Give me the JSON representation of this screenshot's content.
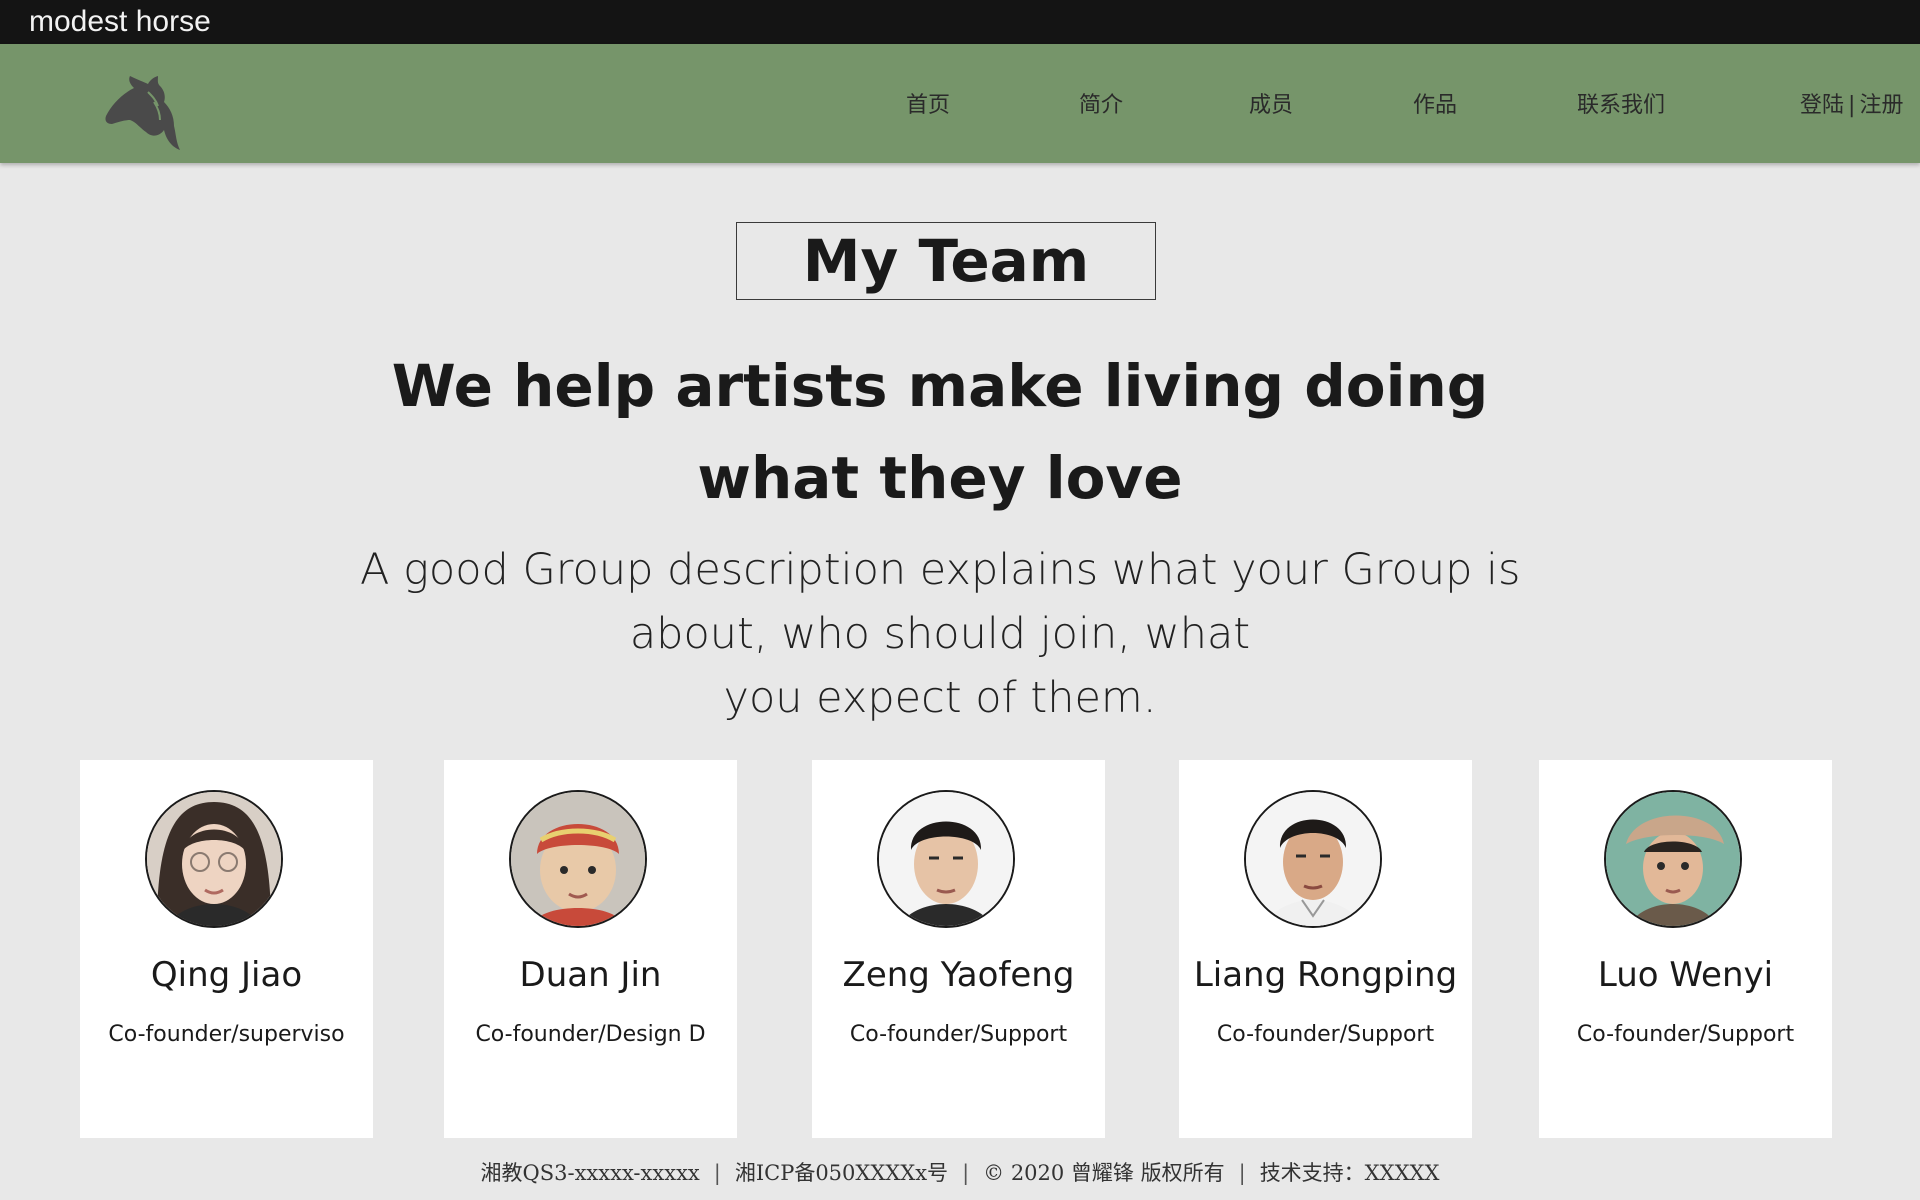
{
  "topbar": {
    "brand": "modest horse"
  },
  "nav": {
    "items": [
      "首页",
      "简介",
      "成员",
      "作品",
      "联系我们"
    ],
    "login": "登陆",
    "separator": "|",
    "register": "注册"
  },
  "hero": {
    "title": "My Team",
    "headline_line1": "We help artists make living doing",
    "headline_line2": "what they love",
    "desc_line1": "A good Group description explains what your Group is",
    "desc_line2": "about, who should join, what",
    "desc_line3": "you expect of them."
  },
  "members": [
    {
      "name": "Qing Jiao",
      "role": "Co-founder/superviso"
    },
    {
      "name": "Duan Jin",
      "role": "Co-founder/Design D"
    },
    {
      "name": "Zeng Yaofeng",
      "role": "Co-founder/Support"
    },
    {
      "name": "Liang Rongping",
      "role": "Co-founder/Support"
    },
    {
      "name": "Luo Wenyi",
      "role": "Co-founder/Support"
    }
  ],
  "footer": {
    "license": "湘教QS3-xxxxx-xxxxx",
    "icp": "湘ICP备050XXXXx号",
    "copyright": "© 2020 曾耀锋 版权所有",
    "support": "技术支持：XXXXX",
    "separator": "|"
  },
  "colors": {
    "topbar": "#141414",
    "navbar": "#76956a",
    "page_bg": "#e8e8e8",
    "card_bg": "#ffffff"
  }
}
